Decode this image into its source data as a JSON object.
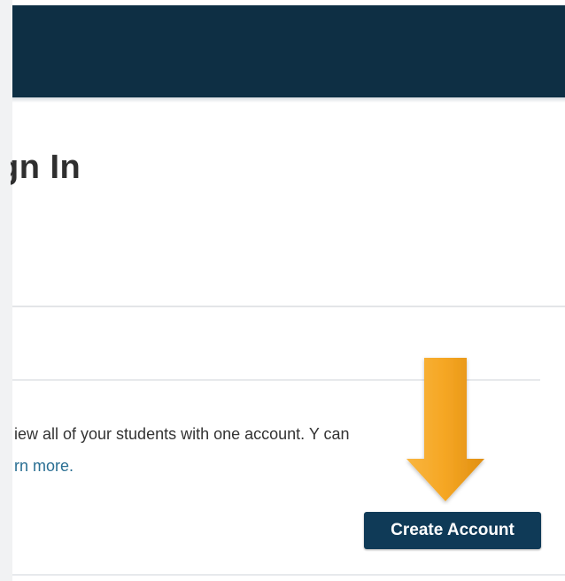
{
  "header": {
    "background_color": "#0e2f44"
  },
  "page": {
    "title": "gn In"
  },
  "description": {
    "line1": "iew all of your students with one account. Y    can",
    "line2_link": "rn more."
  },
  "actions": {
    "create_account_label": "Create Account",
    "button_color": "#0f3a57"
  },
  "annotation": {
    "arrow_icon": "down-arrow-icon",
    "arrow_color": "#f5a623"
  }
}
